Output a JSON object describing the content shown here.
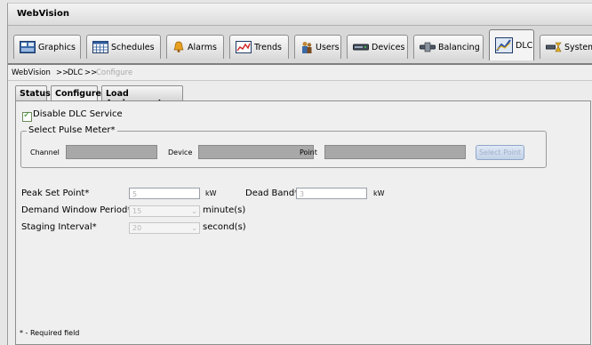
{
  "app": {
    "title": "WebVision"
  },
  "main_tabs": [
    {
      "label": "Graphics",
      "icon": "graphics-icon"
    },
    {
      "label": "Schedules",
      "icon": "schedules-icon"
    },
    {
      "label": "Alarms",
      "icon": "alarms-icon"
    },
    {
      "label": "Trends",
      "icon": "trends-icon"
    },
    {
      "label": "Users",
      "icon": "users-icon"
    },
    {
      "label": "Devices",
      "icon": "devices-icon"
    },
    {
      "label": "Balancing",
      "icon": "balancing-icon"
    },
    {
      "label": "DLC",
      "icon": "dlc-icon",
      "active": true
    },
    {
      "label": "System",
      "icon": "system-icon"
    }
  ],
  "breadcrumb": {
    "root": "WebVision",
    "sep1": ">>",
    "section": "DLC",
    "sep2": ">>",
    "current": "Configure"
  },
  "sub_tabs": [
    {
      "label": "Status"
    },
    {
      "label": "Configure",
      "active": true
    },
    {
      "label": "Load Assignment"
    }
  ],
  "form": {
    "disable_label": "Disable DLC Service",
    "disable_checked": true,
    "pulse_group_title": "Select Pulse Meter*",
    "channel_label": "Channel",
    "device_label": "Device",
    "point_label": "Point",
    "select_point_label": "Select Point",
    "peak_label": "Peak Set Point*",
    "peak_value": "5",
    "peak_unit": "kW",
    "dead_band_label": "Dead Band*",
    "dead_band_value": "3",
    "dead_band_unit": "kW",
    "demand_label": "Demand Window Period*",
    "demand_value": "15",
    "demand_unit": "minute(s)",
    "staging_label": "Staging Interval*",
    "staging_value": "20",
    "staging_unit": "second(s)",
    "required_note": "* - Required field"
  }
}
